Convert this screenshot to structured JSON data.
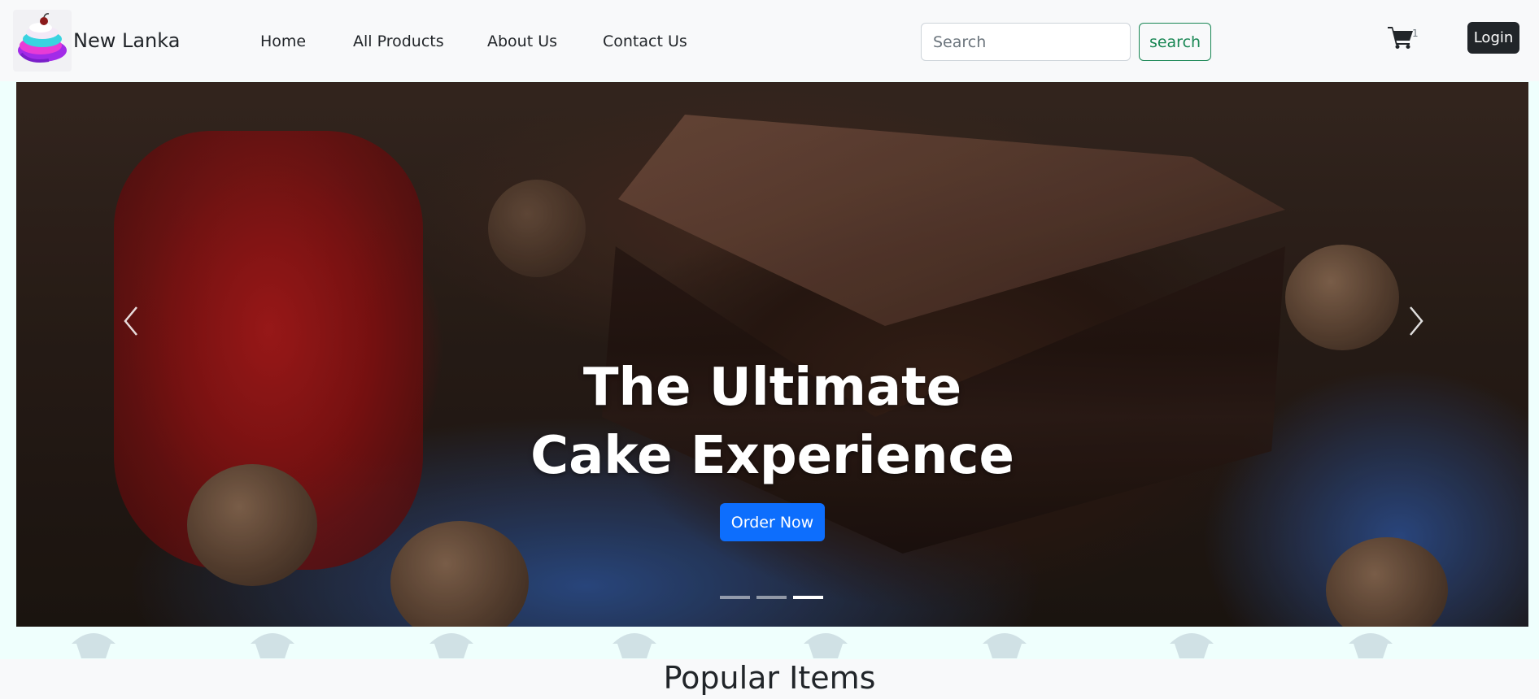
{
  "brand": {
    "name": "New Lanka",
    "logo_icon": "cake-logo-icon"
  },
  "nav": {
    "items": [
      {
        "label": "Home"
      },
      {
        "label": "All Products"
      },
      {
        "label": "About Us"
      },
      {
        "label": "Contact Us"
      }
    ]
  },
  "search": {
    "placeholder": "Search",
    "value": "",
    "button_label": "search"
  },
  "cart": {
    "icon": "cart-icon",
    "count": "1"
  },
  "auth": {
    "login_label": "Login"
  },
  "hero": {
    "title": "The Ultimate\nCake Experience",
    "cta_label": "Order Now",
    "prev_icon": "chevron-left-icon",
    "next_icon": "chevron-right-icon",
    "slide_count": 3,
    "active_slide": 3
  },
  "sections": {
    "popular_title": "Popular Items"
  },
  "colors": {
    "navbar_bg": "#f8f9fa",
    "page_bg": "#eefffd",
    "primary": "#0d6efd",
    "success": "#198754",
    "dark": "#212529"
  }
}
